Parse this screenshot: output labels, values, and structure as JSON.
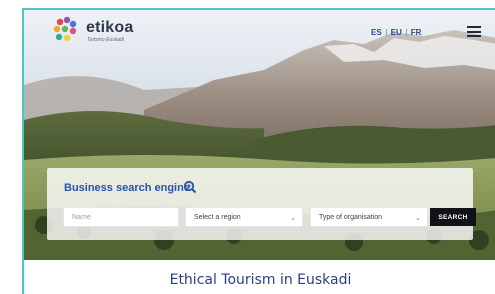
{
  "header": {
    "brand": "etikoa",
    "tagline": "Turismo Euskadi",
    "languages": [
      "ES",
      "EU",
      "FR"
    ],
    "menu_icon": "hamburger-icon"
  },
  "search": {
    "title": "Business search engine",
    "title_icon": "search-icon",
    "name_placeholder": "Name",
    "region_label": "Select a region",
    "organisation_label": "Type of organisation",
    "button_label": "SEARCH"
  },
  "content": {
    "title": "Ethical Tourism in Euskadi"
  },
  "colors": {
    "accent_border": "#4fc7c1",
    "brand_blue": "#2854a7",
    "button_bg": "#101215"
  }
}
